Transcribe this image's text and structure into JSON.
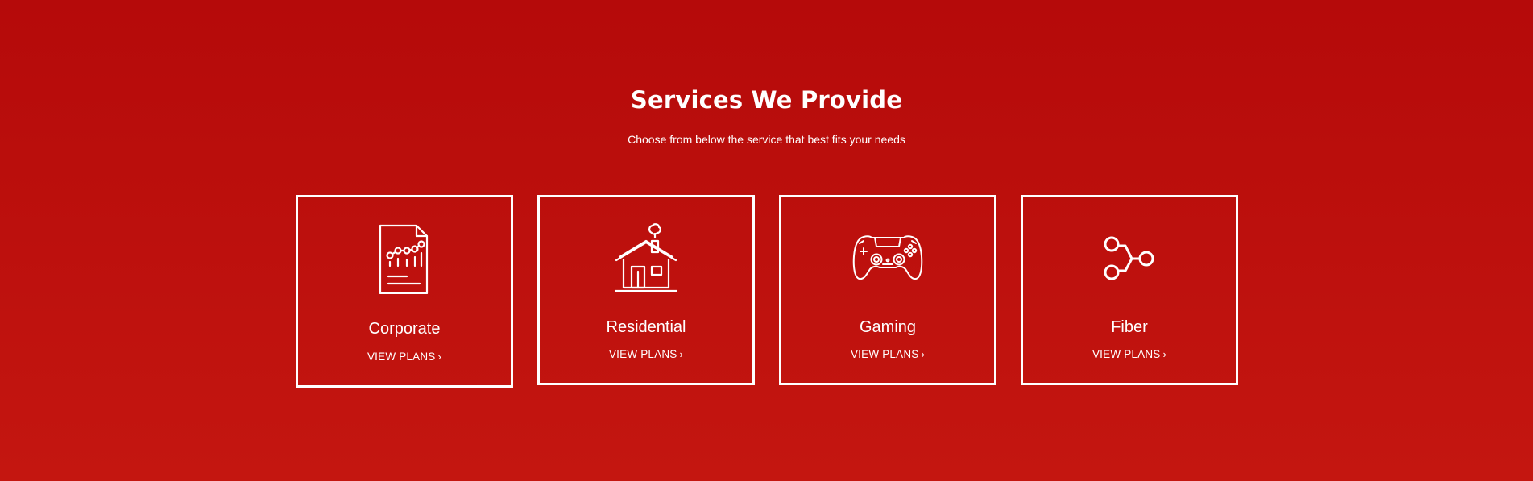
{
  "section": {
    "title": "Services We Provide",
    "subtitle": "Choose from below the service that best fits your needs"
  },
  "cards": [
    {
      "icon": "report-chart-icon",
      "title": "Corporate",
      "link_label": "VIEW PLANS",
      "chevron": "›"
    },
    {
      "icon": "house-icon",
      "title": "Residential",
      "link_label": "VIEW PLANS",
      "chevron": "›"
    },
    {
      "icon": "gamepad-icon",
      "title": "Gaming",
      "link_label": "VIEW PLANS",
      "chevron": "›"
    },
    {
      "icon": "fiber-network-icon",
      "title": "Fiber",
      "link_label": "VIEW PLANS",
      "chevron": "›"
    }
  ],
  "colors": {
    "background_top": "#b50a0a",
    "background_bottom": "#c41610",
    "foreground": "#ffffff"
  }
}
